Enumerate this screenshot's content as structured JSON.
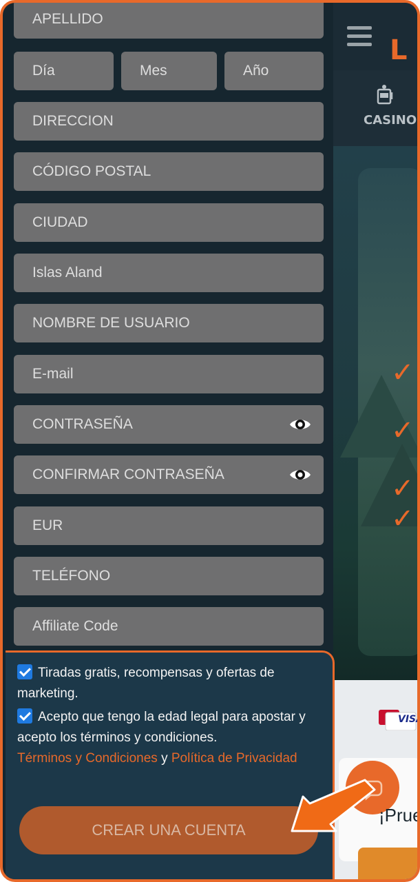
{
  "background_site": {
    "nav_label": "CASINO",
    "promo_text": "¡Prue",
    "payment_logo": "VISA"
  },
  "form": {
    "fields": [
      {
        "id": "apellido",
        "placeholder": "APELLIDO"
      },
      {
        "id": "dia",
        "placeholder": "Día"
      },
      {
        "id": "mes",
        "placeholder": "Mes"
      },
      {
        "id": "ano",
        "placeholder": "Año"
      },
      {
        "id": "direccion",
        "placeholder": "DIRECCION"
      },
      {
        "id": "codigo_postal",
        "placeholder": "CÓDIGO POSTAL"
      },
      {
        "id": "ciudad",
        "placeholder": "CIUDAD"
      },
      {
        "id": "pais",
        "value": "Islas Aland"
      },
      {
        "id": "usuario",
        "placeholder": "NOMBRE DE USUARIO"
      },
      {
        "id": "email",
        "placeholder": "E-mail"
      },
      {
        "id": "contrasena",
        "placeholder": "CONTRASEÑA"
      },
      {
        "id": "confirmar",
        "placeholder": "CONFIRMAR CONTRASEÑA"
      },
      {
        "id": "moneda",
        "value": "EUR"
      },
      {
        "id": "telefono",
        "placeholder": "TELÉFONO"
      },
      {
        "id": "affiliate",
        "placeholder": "Affiliate Code"
      }
    ],
    "consent": {
      "marketing": "Tiradas gratis, recompensas y ofertas de marketing.",
      "legal_age": "Acepto que tengo la edad legal para apostar y acepto los términos y condiciones.",
      "terms_link": "Términos y Condiciones",
      "connector": "y",
      "privacy_link": "Política de Privacidad"
    },
    "submit_label": "CREAR UNA CUENTA"
  },
  "colors": {
    "accent": "#e8692a",
    "field_bg": "#6f6f70",
    "panel_bg": "#16262f",
    "footer_bg": "#1c3849",
    "checkbox": "#1f7ae0",
    "button_bg": "#b05a2d"
  },
  "icons": {
    "password_toggle": "eye-icon",
    "menu": "hamburger-icon",
    "casino": "slot-machine-icon",
    "chat": "chat-icon",
    "pointer": "arrow-icon"
  }
}
